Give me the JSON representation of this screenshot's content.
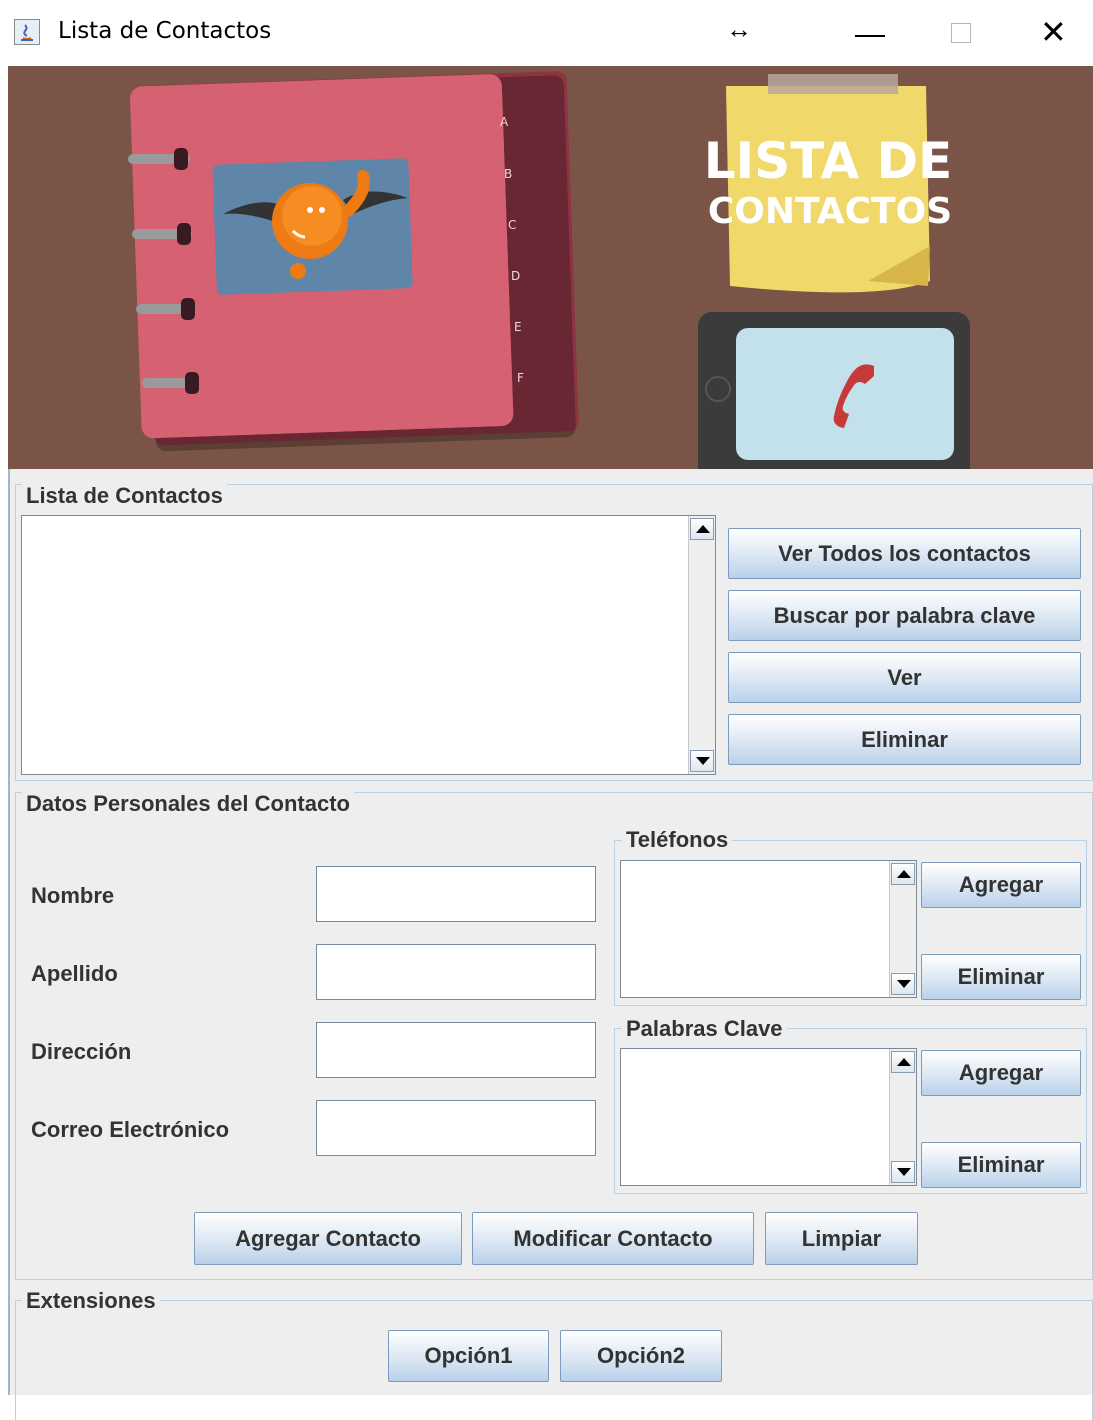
{
  "window": {
    "title": "Lista de Contactos"
  },
  "banner": {
    "tabs": [
      "A",
      "B",
      "C",
      "D",
      "E",
      "F"
    ],
    "note_line1": "LISTA DE",
    "note_line2": "CONTACTOS"
  },
  "contact_list": {
    "title": "Lista de Contactos",
    "buttons": {
      "view_all": "Ver Todos los contactos",
      "search": "Buscar por palabra clave",
      "view": "Ver",
      "delete": "Eliminar"
    }
  },
  "personal": {
    "title": "Datos Personales del Contacto",
    "labels": {
      "name": "Nombre",
      "surname": "Apellido",
      "address": "Dirección",
      "email": "Correo Electrónico"
    },
    "phones": {
      "title": "Teléfonos",
      "add": "Agregar",
      "delete": "Eliminar"
    },
    "keywords": {
      "title": "Palabras Clave",
      "add": "Agregar",
      "delete": "Eliminar"
    },
    "actions": {
      "add": "Agregar Contacto",
      "modify": "Modificar Contacto",
      "clear": "Limpiar"
    }
  },
  "extensions": {
    "title": "Extensiones",
    "opt1": "Opción1",
    "opt2": "Opción2"
  }
}
